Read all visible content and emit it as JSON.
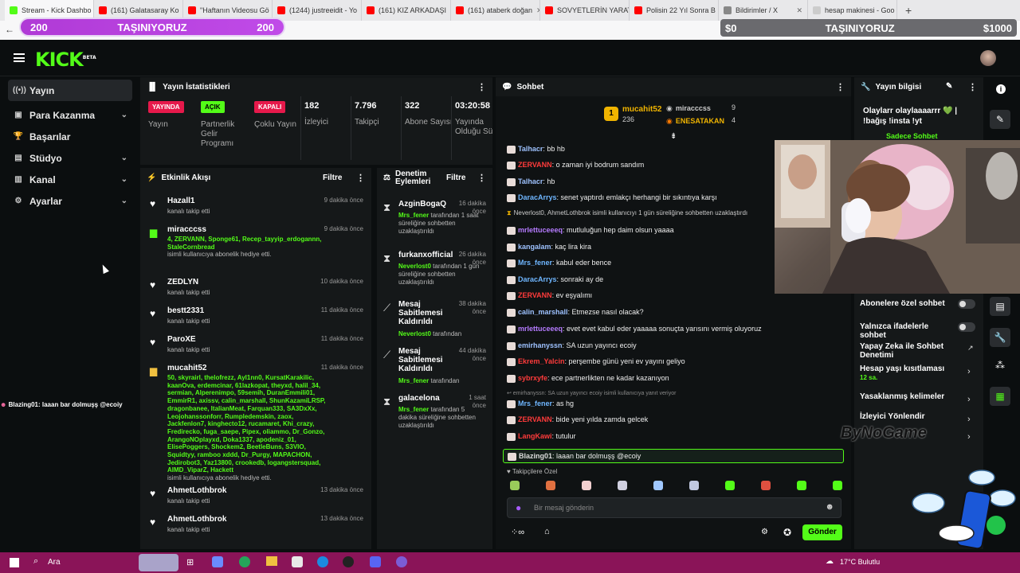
{
  "browser": {
    "tabs": [
      {
        "label": "Stream - Kick Dashbo",
        "color": "#53fc18",
        "active": true
      },
      {
        "label": "(161) Galatasaray Ko",
        "color": "#ff0000"
      },
      {
        "label": "\"Haftanın Videosu Gö",
        "color": "#ff0000"
      },
      {
        "label": "(1244) justreeidit - Yo",
        "color": "#ff0000"
      },
      {
        "label": "(161) KIZ ARKADAŞI",
        "color": "#ff0000"
      },
      {
        "label": "(161) ataberk doğan",
        "color": "#ff0000"
      },
      {
        "label": "SOVYETLERİN YARAT",
        "color": "#ff0000"
      },
      {
        "label": "Polisin 22 Yıl Sonra B",
        "color": "#ff0000"
      },
      {
        "label": "Bildirimler / X",
        "color": "#888888"
      },
      {
        "label": "hesap makinesi - Goo",
        "color": "#cccccc"
      }
    ],
    "new_tab": "+"
  },
  "overlays": {
    "left_num1": "200",
    "left_text": "TAŞINIYORUZ",
    "left_num2": "200",
    "right_amt1": "$0",
    "right_text": "TAŞINIYORUZ",
    "right_amt2": "$1000"
  },
  "header": {
    "logo": "KICK",
    "beta": "BETA"
  },
  "sidebar": {
    "items": [
      {
        "label": "Yayın",
        "icon": "((•))"
      },
      {
        "label": "Para Kazanma",
        "icon": "▣",
        "chev": "⌄"
      },
      {
        "label": "Başarılar",
        "icon": "🏆"
      },
      {
        "label": "Stüdyo",
        "icon": "▤",
        "chev": "⌄"
      },
      {
        "label": "Kanal",
        "icon": "▥",
        "chev": "⌄"
      },
      {
        "label": "Ayarlar",
        "icon": "⚙",
        "chev": "⌄"
      }
    ]
  },
  "overlay_chat_line": {
    "user": "Blazing01",
    "text": ": laaan bar dolmuşş @ecoiy"
  },
  "stats": {
    "title": "Yayın İstatistikleri",
    "items": [
      {
        "badge": "YAYINDA",
        "label": "Yayın"
      },
      {
        "badge": "AÇIK",
        "label": "Partnerlik Gelir Programı"
      },
      {
        "badge": "KAPALI",
        "label": "Çoklu Yayın"
      },
      {
        "value": "182",
        "label": "İzleyici"
      },
      {
        "value": "7.796",
        "label": "Takipçi"
      },
      {
        "value": "322",
        "label": "Abone Sayısı"
      },
      {
        "value": "03:20:58",
        "label": "Yayında Olduğu Süre"
      }
    ]
  },
  "activity": {
    "title": "Etkinlik Akışı",
    "filter": "Filtre",
    "events": [
      {
        "name": "Hazall1",
        "time": "9 dakika önce",
        "sub": "kanalı takip etti"
      },
      {
        "name": "miracccss",
        "time": "9 dakika önce",
        "green": "4, ZERVANN, Sponge61, Recep_tayyip_erdogannn, StaleCornbread",
        "sub": "isimli kullanıcıya abonelik hediye etti."
      },
      {
        "name": "ZEDLYN",
        "time": "10 dakika önce",
        "sub": "kanalı takip etti"
      },
      {
        "name": "bestt2331",
        "time": "11 dakika önce",
        "sub": "kanalı takip etti"
      },
      {
        "name": "ParoXE",
        "time": "11 dakika önce",
        "sub": "kanalı takip etti"
      },
      {
        "name": "mucahit52",
        "time": "11 dakika önce",
        "green": "50, skyrairl, thelofrezz, Ayl1nn0, KursatKarakilic, kaanOva, erdemcinar, 61lazkopat, theyxd, halil_34, sermian, Alperenimpo, 59semih, DuranEmmili01, EmmirR1, axissv, calin_marshall, ShunKazamiLRSP, dragonbanee, ItalianMeat, Farquan333, SA3DxXx, Leojohanssonforr, Rumpledemskin, zaox, Jackfenlon7, kinghecto12, rucamaret, Khi_crazy, Fredirecko, fuga_saepe, Pipex, oliammo, Dr_Gonzo, ArangoNOplayxd, Doka1337, apodeniz_01, ElisePoggers, Shockem2, BeetleBuns, S3VIO, Squidtyy, ramboo xddd, Dr_Purgy, MAPACHON, Jedirobot3, Yaz13800, crookedb, logangstersquad, AIMD_ViparZ, Hackett",
        "sub": "isimli kullanıcıya abonelik hediye etti."
      },
      {
        "name": "AhmetLothbrok",
        "time": "13 dakika önce",
        "sub": "kanalı takip etti"
      },
      {
        "name": "AhmetLothbrok",
        "time": "13 dakika önce",
        "sub": "kanalı takip etti"
      }
    ]
  },
  "moderation": {
    "title": "Denetim Eylemleri",
    "filter": "Filtre",
    "items": [
      {
        "name": "AzginBogaQ",
        "time": "16 dakika önce",
        "actor": "Mrs_fener",
        "desc": " tarafından 1 saat süreliğine sohbetten uzaklaştırıldı"
      },
      {
        "name": "furkanxofficial",
        "time": "26 dakika önce",
        "actor": "Neverlost0",
        "desc": " tarafından 1 gün süreliğine sohbetten uzaklaştırıldı"
      },
      {
        "name": "Mesaj Sabitlemesi Kaldırıldı",
        "time": "38 dakika önce",
        "actor": "Neverlost0",
        "desc": " tarafından"
      },
      {
        "name": "Mesaj Sabitlemesi Kaldırıldı",
        "time": "44 dakika önce",
        "actor": "Mrs_fener",
        "desc": " tarafından"
      },
      {
        "name": "galacelona",
        "time": "1 saat önce",
        "actor": "Mrs_fener",
        "desc": " tarafından 5 dakika süreliğine sohbetten uzaklaştırıldı"
      }
    ]
  },
  "chat": {
    "title": "Sohbet",
    "leaders": [
      {
        "rank": "1",
        "name": "mucahit52",
        "count": "236"
      },
      {
        "name": "miracccss",
        "count": "9"
      },
      {
        "name": "ENESATAKAN",
        "count": "4"
      }
    ],
    "messages": [
      {
        "user": "Talhacr",
        "color": "#9ec2ff",
        "text": ": bb hb"
      },
      {
        "user": "ZERVANN",
        "color": "#ff3b3b",
        "text": ": o zaman iyi bodrum sandım"
      },
      {
        "user": "Talhacr",
        "color": "#9ec2ff",
        "text": ": hb"
      },
      {
        "user": "DaracArrys",
        "color": "#6fb6ff",
        "text": ": senet yaptırdı emlakçı herhangi bir sıkıntıya karşı"
      },
      {
        "system": "Neverlost0, AhmetLothbrok isimli kullanıcıyı 1 gün süreliğine sohbetten uzaklaştırdı"
      },
      {
        "user": "mrlettuceeeq",
        "color": "#b57bff",
        "text": ": mutluluğun hep daim olsun yaaaa"
      },
      {
        "user": "kangalam",
        "color": "#9ec2ff",
        "text": ": kaç lira kira"
      },
      {
        "user": "Mrs_fener",
        "color": "#6fb6ff",
        "text": ": kabul eder bence"
      },
      {
        "user": "DaracArrys",
        "color": "#6fb6ff",
        "text": ": sonraki ay de"
      },
      {
        "user": "ZERVANN",
        "color": "#ff3b3b",
        "text": ": ev eşyalımı"
      },
      {
        "user": "calin_marshall",
        "color": "#9ec2ff",
        "text": ": Etmezse nasıl olacak?"
      },
      {
        "user": "mrlettuceeeq",
        "color": "#b57bff",
        "text": ": evet evet kabul eder yaaaaa sonuçta yarısını vermiş oluyoruz"
      },
      {
        "user": "emirhanyssn",
        "color": "#9ec2ff",
        "text": ": SA uzun yayıncı ecoiy"
      },
      {
        "user": "Ekrem_Yalcin",
        "color": "#ff3b3b",
        "text": ": perşembe günü yeni ev yayını geliyo"
      },
      {
        "user": "sybrxyfe",
        "color": "#ff3b3b",
        "text": ": ece partnerlikten ne kadar kazanıyon"
      },
      {
        "reply": "↩ emirhanyssn: SA uzun yayıncı ecoiy isimli kullanıcıya yanıt veriyor"
      },
      {
        "user": "Mrs_fener",
        "color": "#6fb6ff",
        "text": ": as hg"
      },
      {
        "user": "ZERVANN",
        "color": "#ff3b3b",
        "text": ": bide yeni yılda zamda gelcek"
      },
      {
        "user": "LangKawi",
        "color": "#ff3b3b",
        "text": ": tutulur"
      },
      {
        "user": "Blazing01",
        "color": "#dddddd",
        "text": ": laaan bar dolmuşş @ecoiy",
        "highlight": true
      }
    ],
    "followers_only": "Takipçilere Özel",
    "input_placeholder": "Bir mesaj gönderin",
    "send": "Gönder"
  },
  "info": {
    "title": "Yayın bilgisi",
    "stream_title": "Olaylarr olaylaaaarrr 💚 | !bağış !insta !yt",
    "chat_mode": "Sadece Sohbet",
    "rows": [
      {
        "label": "Abonelere özel sohbet",
        "type": "toggle"
      },
      {
        "label": "Yalnızca ifadelerle sohbet",
        "type": "toggle"
      },
      {
        "label": "Yapay Zeka ile Sohbet Denetimi",
        "type": "link"
      },
      {
        "label": "Hesap yaşı kısıtlaması",
        "sub": "12 sa.",
        "type": "chev"
      },
      {
        "label": "Yasaklanmış kelimeler",
        "type": "chev"
      },
      {
        "label": "İzleyici Yönlendir",
        "type": "chev"
      }
    ],
    "watermark": "ByNoGame"
  },
  "taskbar": {
    "search": "Ara",
    "weather": "17°C Bulutlu"
  },
  "colors": {
    "brand": "#53fc18",
    "live": "#e6194b",
    "kapali": "#e6194b",
    "acik": "#53fc18"
  }
}
